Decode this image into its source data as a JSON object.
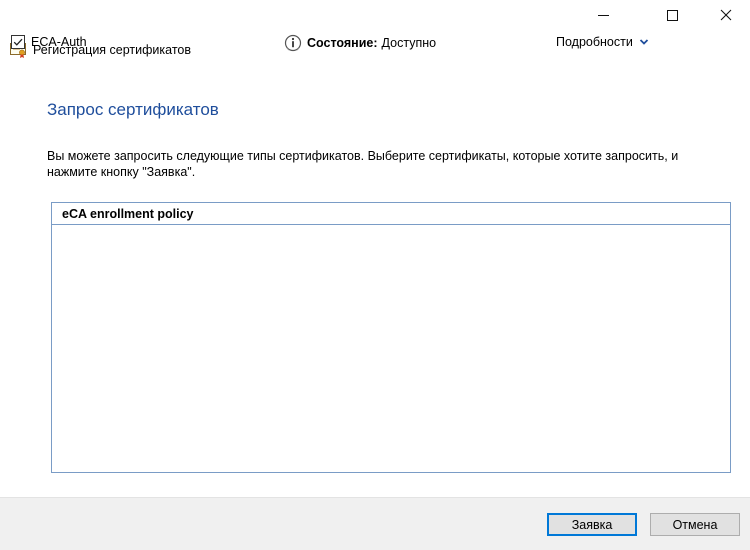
{
  "window": {
    "title": "Регистрация сертификатов",
    "icon": "certificate-icon",
    "controls": [
      "minimize-icon",
      "maximize-icon",
      "close-icon"
    ]
  },
  "main": {
    "heading": "Запрос сертификатов",
    "description": "Вы можете запросить следующие типы сертификатов. Выберите сертификаты, которые хотите запросить, и нажмите кнопку \"Заявка\"."
  },
  "policy": {
    "header": "eCA enrollment policy",
    "items": [
      {
        "name": "ECA-Auth",
        "checked": true,
        "status_label": "Состояние:",
        "status_value": "Доступно",
        "details_label": "Подробности"
      }
    ]
  },
  "footer": {
    "enroll_label": "Заявка",
    "cancel_label": "Отмена"
  },
  "colors": {
    "heading": "#1f4e9c",
    "border": "#7a9cc6",
    "accent": "#0078d7"
  }
}
